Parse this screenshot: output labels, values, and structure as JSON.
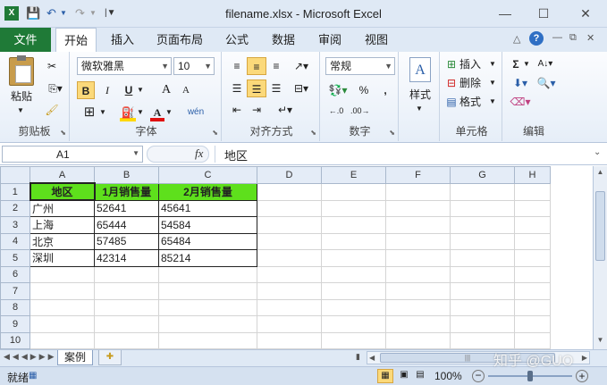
{
  "window": {
    "title": "filename.xlsx - Microsoft Excel",
    "min": "—",
    "max": "☐",
    "close": "✕"
  },
  "tabs": {
    "file": "文件",
    "items": [
      "开始",
      "插入",
      "页面布局",
      "公式",
      "数据",
      "审阅",
      "视图"
    ]
  },
  "ribbon": {
    "clipboard": {
      "paste": "粘贴",
      "label": "剪贴板"
    },
    "font": {
      "name": "微软雅黑",
      "size": "10",
      "bold": "B",
      "italic": "I",
      "underline": "U",
      "grow": "A",
      "shrink": "A",
      "label": "字体",
      "phonetic": "wén"
    },
    "align": {
      "label": "对齐方式"
    },
    "number": {
      "format": "常规",
      "percent": "%",
      "comma": ",",
      "label": "数字"
    },
    "styles": {
      "btn": "样式"
    },
    "cells": {
      "insert": "插入",
      "delete": "删除",
      "format": "格式",
      "label": "单元格"
    },
    "edit": {
      "sum": "Σ",
      "label": "编辑"
    }
  },
  "formula_bar": {
    "name_box": "A1",
    "fx": "fx",
    "content": "地区"
  },
  "sheet": {
    "columns": [
      "A",
      "B",
      "C",
      "D",
      "E",
      "F",
      "G",
      "H"
    ],
    "rows": [
      "1",
      "2",
      "3",
      "4",
      "5",
      "6",
      "7",
      "8",
      "9",
      "10"
    ],
    "header": [
      "地区",
      "1月销售量",
      "2月销售量"
    ],
    "data": [
      [
        "广州",
        "52641",
        "45641"
      ],
      [
        "上海",
        "65444",
        "54584"
      ],
      [
        "北京",
        "57485",
        "65484"
      ],
      [
        "深圳",
        "42314",
        "85214"
      ]
    ]
  },
  "sheet_tabs": {
    "active": "案例"
  },
  "status": {
    "ready": "就绪",
    "zoom": "100%",
    "watermark": "知乎 @GUO"
  }
}
